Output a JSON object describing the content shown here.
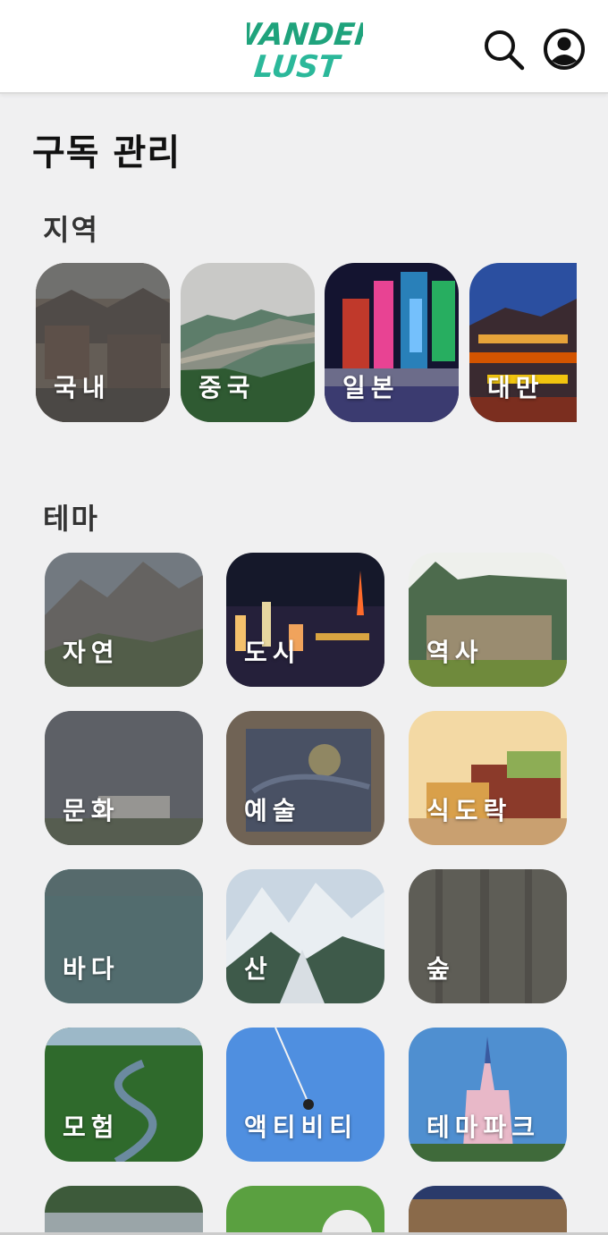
{
  "header": {
    "logo_line1": "WANDER",
    "logo_line2": "LUST",
    "icons": [
      "search-icon",
      "profile-icon"
    ],
    "brand_color": "#1fa37c"
  },
  "page": {
    "title": "구독 관리"
  },
  "regions": {
    "heading": "지역",
    "items": [
      {
        "label": "국내",
        "selected": false
      },
      {
        "label": "중국",
        "selected": true
      },
      {
        "label": "일본",
        "selected": true
      },
      {
        "label": "대만",
        "selected": true
      }
    ]
  },
  "themes": {
    "heading": "테마",
    "items": [
      {
        "label": "자연",
        "selected": false
      },
      {
        "label": "도시",
        "selected": true
      },
      {
        "label": "역사",
        "selected": true
      },
      {
        "label": "문화",
        "selected": false
      },
      {
        "label": "예술",
        "selected": false
      },
      {
        "label": "식도락",
        "selected": true
      },
      {
        "label": "바다",
        "selected": false
      },
      {
        "label": "산",
        "selected": true
      },
      {
        "label": "숲",
        "selected": false
      },
      {
        "label": "모험",
        "selected": true
      },
      {
        "label": "액티비티",
        "selected": true
      },
      {
        "label": "테마파크",
        "selected": true
      }
    ]
  }
}
